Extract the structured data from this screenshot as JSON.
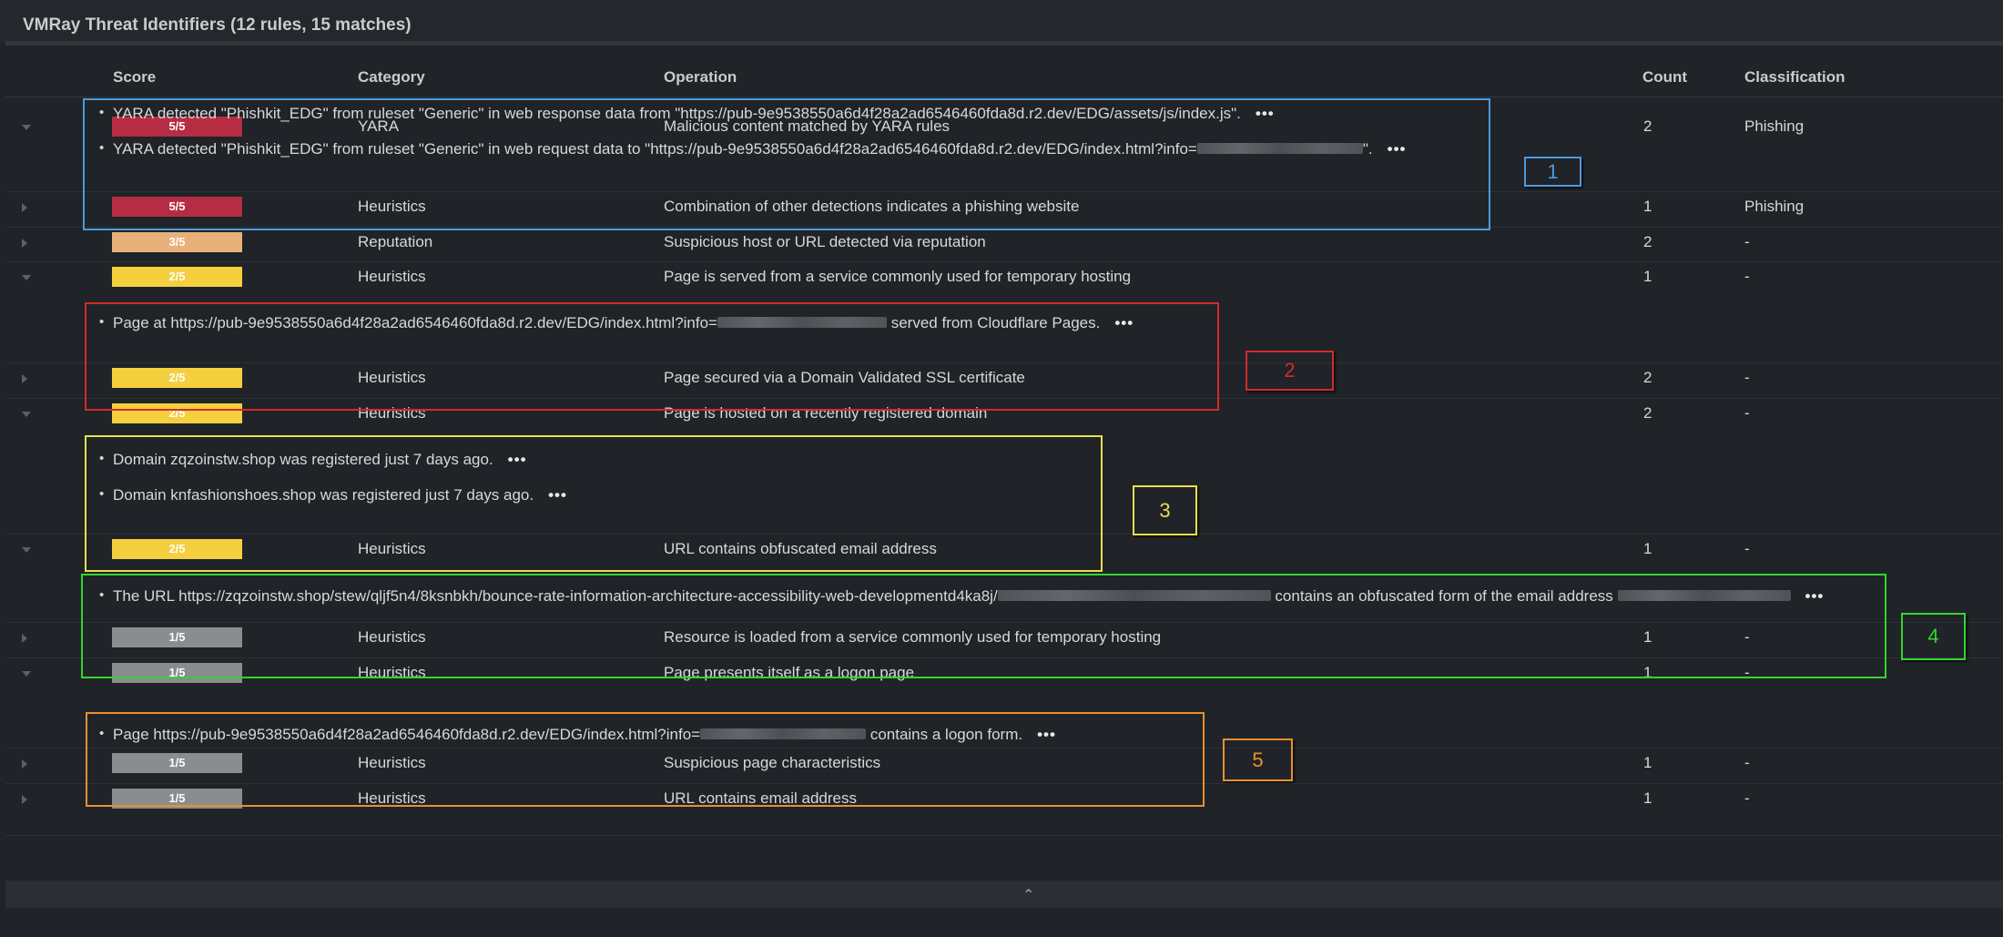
{
  "panel": {
    "title": "VMRay Threat Identifiers (12 rules, 15 matches)"
  },
  "columns": {
    "score": "Score",
    "category": "Category",
    "operation": "Operation",
    "count": "Count",
    "classification": "Classification"
  },
  "colors": {
    "score_5": "#b62d43",
    "score_3": "#e9b07a",
    "score_2": "#f4d03f",
    "score_1": "#8a8c8f"
  },
  "rows": [
    {
      "score": "5/5",
      "category": "YARA",
      "operation": "Malicious content matched by YARA rules",
      "count": "2",
      "classification": "Phishing",
      "expanded": true,
      "details": [
        {
          "text": "YARA detected \"Phishkit_EDG\" from ruleset \"Generic\" in web response data from \"https://pub-9e9538550a6d4f28a2ad6546460fda8d.r2.dev/EDG/assets/js/index.js\".",
          "after": ""
        },
        {
          "text": "YARA detected \"Phishkit_EDG\" from ruleset \"Generic\" in web request data to \"https://pub-9e9538550a6d4f28a2ad6546460fda8d.r2.dev/EDG/index.html?info=",
          "after": "\"."
        }
      ]
    },
    {
      "score": "5/5",
      "category": "Heuristics",
      "operation": "Combination of other detections indicates a phishing website",
      "count": "1",
      "classification": "Phishing",
      "expanded": false
    },
    {
      "score": "3/5",
      "category": "Reputation",
      "operation": "Suspicious host or URL detected via reputation",
      "count": "2",
      "classification": "-",
      "expanded": false
    },
    {
      "score": "2/5",
      "category": "Heuristics",
      "operation": "Page is served from a service commonly used for temporary hosting",
      "count": "1",
      "classification": "-",
      "expanded": true,
      "details": [
        {
          "text": "Page at https://pub-9e9538550a6d4f28a2ad6546460fda8d.r2.dev/EDG/index.html?info=",
          "after": " served from Cloudflare Pages."
        }
      ]
    },
    {
      "score": "2/5",
      "category": "Heuristics",
      "operation": "Page secured via a Domain Validated SSL certificate",
      "count": "2",
      "classification": "-",
      "expanded": false
    },
    {
      "score": "2/5",
      "category": "Heuristics",
      "operation": "Page is hosted on a recently registered domain",
      "count": "2",
      "classification": "-",
      "expanded": true,
      "details": [
        {
          "text": "Domain zqzoinstw.shop was registered just 7 days ago.",
          "after": ""
        },
        {
          "text": "Domain knfashionshoes.shop was registered just 7 days ago.",
          "after": ""
        }
      ]
    },
    {
      "score": "2/5",
      "category": "Heuristics",
      "operation": "URL contains obfuscated email address",
      "count": "1",
      "classification": "-",
      "expanded": true,
      "details": [
        {
          "text": "The URL https://zqzoinstw.shop/stew/qljf5n4/8ksnbkh/bounce-rate-information-architecture-accessibility-web-developmentd4ka8j/",
          "after": " contains an obfuscated form of the email address "
        }
      ]
    },
    {
      "score": "1/5",
      "category": "Heuristics",
      "operation": "Resource is loaded from a service commonly used for temporary hosting",
      "count": "1",
      "classification": "-",
      "expanded": false
    },
    {
      "score": "1/5",
      "category": "Heuristics",
      "operation": "Page presents itself as a logon page",
      "count": "1",
      "classification": "-",
      "expanded": true,
      "details": [
        {
          "text": "Page https://pub-9e9538550a6d4f28a2ad6546460fda8d.r2.dev/EDG/index.html?info=",
          "after": " contains a logon form."
        }
      ]
    },
    {
      "score": "1/5",
      "category": "Heuristics",
      "operation": "Suspicious page characteristics",
      "count": "1",
      "classification": "-",
      "expanded": false
    },
    {
      "score": "1/5",
      "category": "Heuristics",
      "operation": "URL contains email address",
      "count": "1",
      "classification": "-",
      "expanded": false
    }
  ],
  "annotations": [
    {
      "label": "1",
      "color": "#4a9be0"
    },
    {
      "label": "2",
      "color": "#d42a2a"
    },
    {
      "label": "3",
      "color": "#e8e04a"
    },
    {
      "label": "4",
      "color": "#33d433"
    },
    {
      "label": "5",
      "color": "#e8902e"
    }
  ],
  "more_icon": "more-horizontal-icon",
  "footer_icon": "chevron-up-icon"
}
